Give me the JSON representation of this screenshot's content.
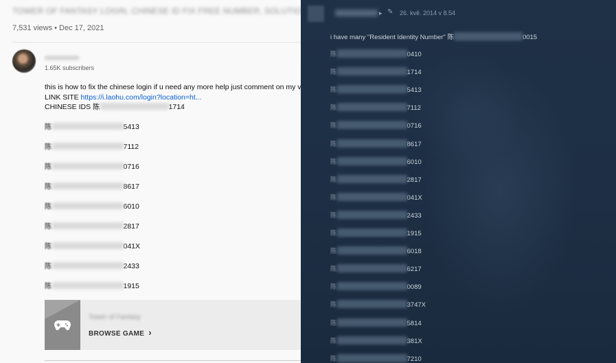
{
  "video": {
    "title": "TOWER OF FANTASY LOGIN, CHINESE ID FIX FREE NUMBER, SOLUTION",
    "meta": "7,531 views • Dec 17, 2021",
    "channel": "xxxxxxxxxx",
    "subscribers": "1.65K subscribers",
    "description_line1": "this is how to fix the chinese login if u need any more help just comment on my video",
    "link_label": "LINK SITE",
    "link_url": "https://i.laohu.com/login?location=ht...",
    "chinese_ids_label": "CHINESE IDS",
    "chinese_ids_first_char": "陈",
    "chinese_ids_first_suffix": "1714",
    "id_char": "陈",
    "id_suffixes": [
      "5413",
      "7112",
      "0716",
      "8617",
      "6010",
      "2817",
      "041X",
      "2433",
      "1915"
    ],
    "game_name": "Tower of Fantasy",
    "browse_game": "BROWSE GAME",
    "browse_chevron": "›"
  },
  "comment": {
    "author": "xxxxxxx",
    "date": "26. kvě. 2014 v 8.54",
    "body_text": "i have many \"Resident Identity Number\"",
    "body_char": "陈",
    "body_suffix": "0015",
    "id_char": "陈",
    "id_suffixes": [
      "0410",
      "1714",
      "5413",
      "7112",
      "0716",
      "8617",
      "6010",
      "2817",
      "041X",
      "2433",
      "1915",
      "6018",
      "6217",
      "0089",
      "3747X",
      "5814",
      "381X",
      "7210"
    ]
  },
  "icons": {
    "gamepad": "gamepad-icon",
    "pin": "pin-icon",
    "arrow": "arrow-icon"
  },
  "colors": {
    "youtube_bg": "#f9f9f9",
    "link": "#065fd4",
    "steam_bg": "#1f3147",
    "steam_text": "#cdd5dd"
  }
}
